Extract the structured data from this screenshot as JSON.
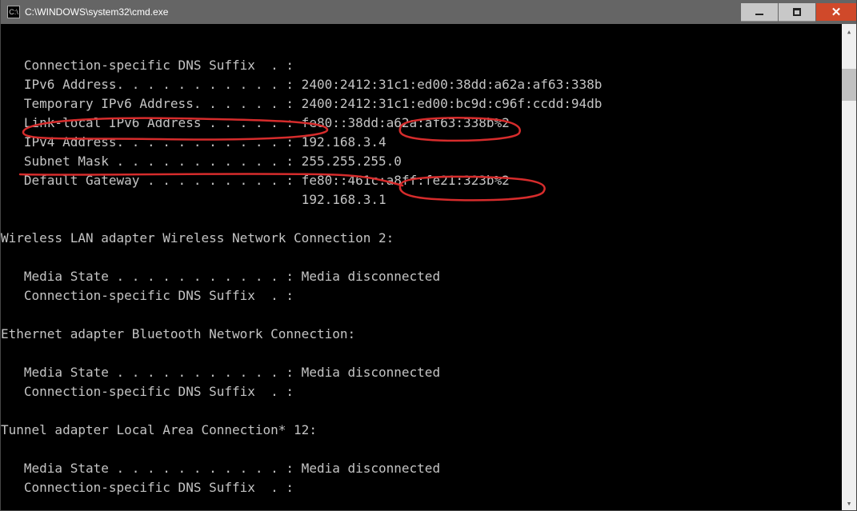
{
  "window": {
    "title": "C:\\WINDOWS\\system32\\cmd.exe",
    "icon_label": "C:\\"
  },
  "terminal": {
    "lines": [
      "",
      "   Connection-specific DNS Suffix  . :",
      "   IPv6 Address. . . . . . . . . . . : 2400:2412:31c1:ed00:38dd:a62a:af63:338b",
      "   Temporary IPv6 Address. . . . . . : 2400:2412:31c1:ed00:bc9d:c96f:ccdd:94db",
      "   Link-local IPv6 Address . . . . . : fe80::38dd:a62a:af63:338b%2",
      "   IPv4 Address. . . . . . . . . . . : 192.168.3.4",
      "   Subnet Mask . . . . . . . . . . . : 255.255.255.0",
      "   Default Gateway . . . . . . . . . : fe80::461c:a8ff:fe21:323b%2",
      "                                       192.168.3.1",
      "",
      "Wireless LAN adapter Wireless Network Connection 2:",
      "",
      "   Media State . . . . . . . . . . . : Media disconnected",
      "   Connection-specific DNS Suffix  . :",
      "",
      "Ethernet adapter Bluetooth Network Connection:",
      "",
      "   Media State . . . . . . . . . . . : Media disconnected",
      "   Connection-specific DNS Suffix  . :",
      "",
      "Tunnel adapter Local Area Connection* 12:",
      "",
      "   Media State . . . . . . . . . . . : Media disconnected",
      "   Connection-specific DNS Suffix  . :",
      ""
    ]
  },
  "annotation": {
    "color": "#d62c2c"
  },
  "network": {
    "connection_specific_dns_suffix": "",
    "ipv6_address": "2400:2412:31c1:ed00:38dd:a62a:af63:338b",
    "temporary_ipv6_address": "2400:2412:31c1:ed00:bc9d:c96f:ccdd:94db",
    "link_local_ipv6_address": "fe80::38dd:a62a:af63:338b%2",
    "ipv4_address": "192.168.3.4",
    "subnet_mask": "255.255.255.0",
    "default_gateway_ipv6": "fe80::461c:a8ff:fe21:323b%2",
    "default_gateway_ipv4": "192.168.3.1",
    "adapters": [
      {
        "name": "Wireless LAN adapter Wireless Network Connection 2",
        "media_state": "Media disconnected",
        "dns_suffix": ""
      },
      {
        "name": "Ethernet adapter Bluetooth Network Connection",
        "media_state": "Media disconnected",
        "dns_suffix": ""
      },
      {
        "name": "Tunnel adapter Local Area Connection* 12",
        "media_state": "Media disconnected",
        "dns_suffix": ""
      }
    ]
  }
}
